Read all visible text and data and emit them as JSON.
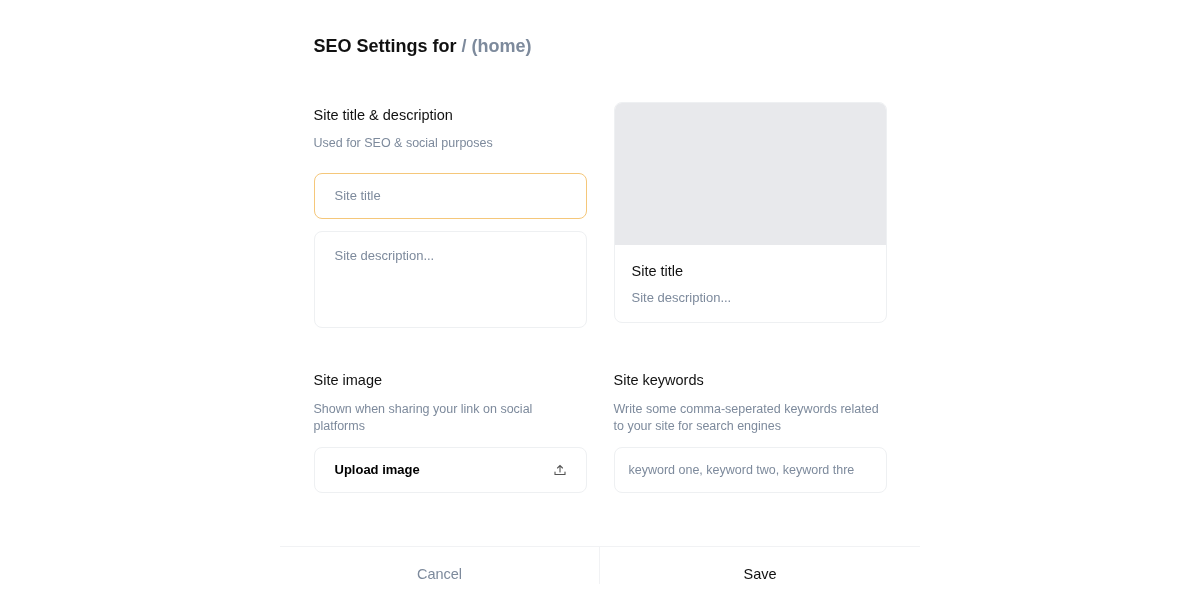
{
  "heading": {
    "title": "SEO Settings for",
    "path": "/ (home)"
  },
  "title_section": {
    "label": "Site title & description",
    "hint": "Used for SEO & social purposes",
    "title_field": {
      "placeholder": "Site title",
      "focused": true
    },
    "description_field": {
      "placeholder": "Site description..."
    }
  },
  "preview": {
    "title": "Site title",
    "description": "Site description..."
  },
  "image_section": {
    "label": "Site image",
    "hint": "Shown when sharing your link on social platforms",
    "upload_button": "Upload image"
  },
  "keywords_section": {
    "label": "Site keywords",
    "hint": "Write some comma-seperated keywords related to your site for search engines",
    "field": {
      "placeholder": "keyword one, keyword two, keyword thre"
    }
  },
  "footer": [
    {
      "label": "Cancel",
      "kind": "secondary"
    },
    {
      "label": "Save",
      "kind": "primary"
    }
  ]
}
